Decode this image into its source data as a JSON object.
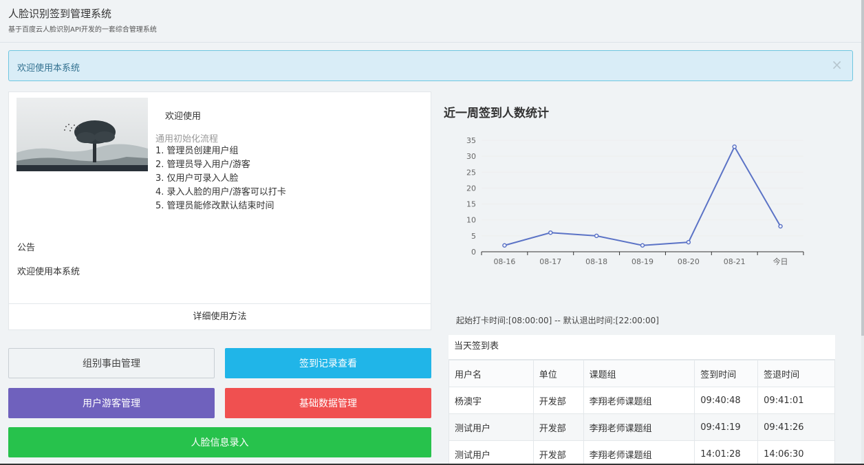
{
  "header": {
    "title": "人脸识别签到管理系统",
    "subtitle": "基于百度云人脸识别API开发的一套综合管理系统"
  },
  "alert": {
    "message": "欢迎使用本系统",
    "close_symbol": "×"
  },
  "intro": {
    "welcome": "欢迎使用",
    "flow_title": "通用初始化流程",
    "steps": [
      "1. 管理员创建用户组",
      "2. 管理员导入用户/游客",
      "3. 仅用户可录入人脸",
      "4. 录入人脸的用户/游客可以打卡",
      "5. 管理员能修改默认结束时间"
    ],
    "notice_title": "公告",
    "notice_text": "欢迎使用本系统",
    "detail_link": "详细使用方法"
  },
  "actions": {
    "group": "组别事由管理",
    "record": "签到记录查看",
    "user": "用户游客管理",
    "basic": "基础数据管理",
    "face": "人脸信息录入"
  },
  "chart_heading": "近一周签到人数统计",
  "chart_data": {
    "type": "line",
    "categories": [
      "08-16",
      "08-17",
      "08-18",
      "08-19",
      "08-20",
      "08-21",
      "今日"
    ],
    "values": [
      2,
      6,
      5,
      2,
      3,
      33,
      8
    ],
    "ylim": [
      0,
      35
    ],
    "yticks": [
      "0",
      "5",
      "10",
      "15",
      "20",
      "25",
      "30",
      "35"
    ],
    "grid": true,
    "color": "#5b73c6"
  },
  "time_info": "起始打卡时间:[08:00:00] -- 默认退出时间:[22:00:00]",
  "today_table": {
    "caption": "当天签到表",
    "headers": [
      "用户名",
      "单位",
      "课题组",
      "签到时间",
      "签退时间"
    ],
    "rows": [
      [
        "杨澳宇",
        "开发部",
        "李翔老师课题组",
        "09:40:48",
        "09:41:01"
      ],
      [
        "测试用户",
        "开发部",
        "李翔老师课题组",
        "09:41:19",
        "09:41:26"
      ],
      [
        "测试用户",
        "开发部",
        "李翔老师课题组",
        "14:01:28",
        "14:06:30"
      ]
    ]
  }
}
